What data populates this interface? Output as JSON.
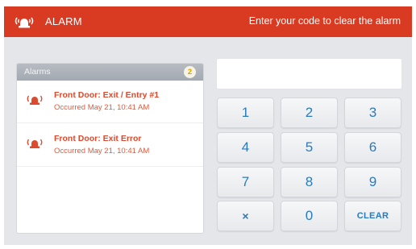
{
  "topbar": {
    "icon": "alarm-siren-icon",
    "title": "ALARM",
    "instruction": "Enter your code to clear the alarm",
    "background_color": "#d83a22"
  },
  "alarms": {
    "header_label": "Alarms",
    "count": "2",
    "items": [
      {
        "icon": "alarm-siren-icon",
        "title": "Front Door: Exit / Entry #1",
        "time": "Occurred May 21, 10:41 AM"
      },
      {
        "icon": "alarm-siren-icon",
        "title": "Front Door: Exit Error",
        "time": "Occurred May 21, 10:41 AM"
      }
    ]
  },
  "code_display": {
    "value": ""
  },
  "keypad": {
    "keys": [
      "1",
      "2",
      "3",
      "4",
      "5",
      "6",
      "7",
      "8",
      "9",
      "×",
      "0",
      "CLEAR"
    ],
    "key_text_color": "#2a7bbd"
  }
}
